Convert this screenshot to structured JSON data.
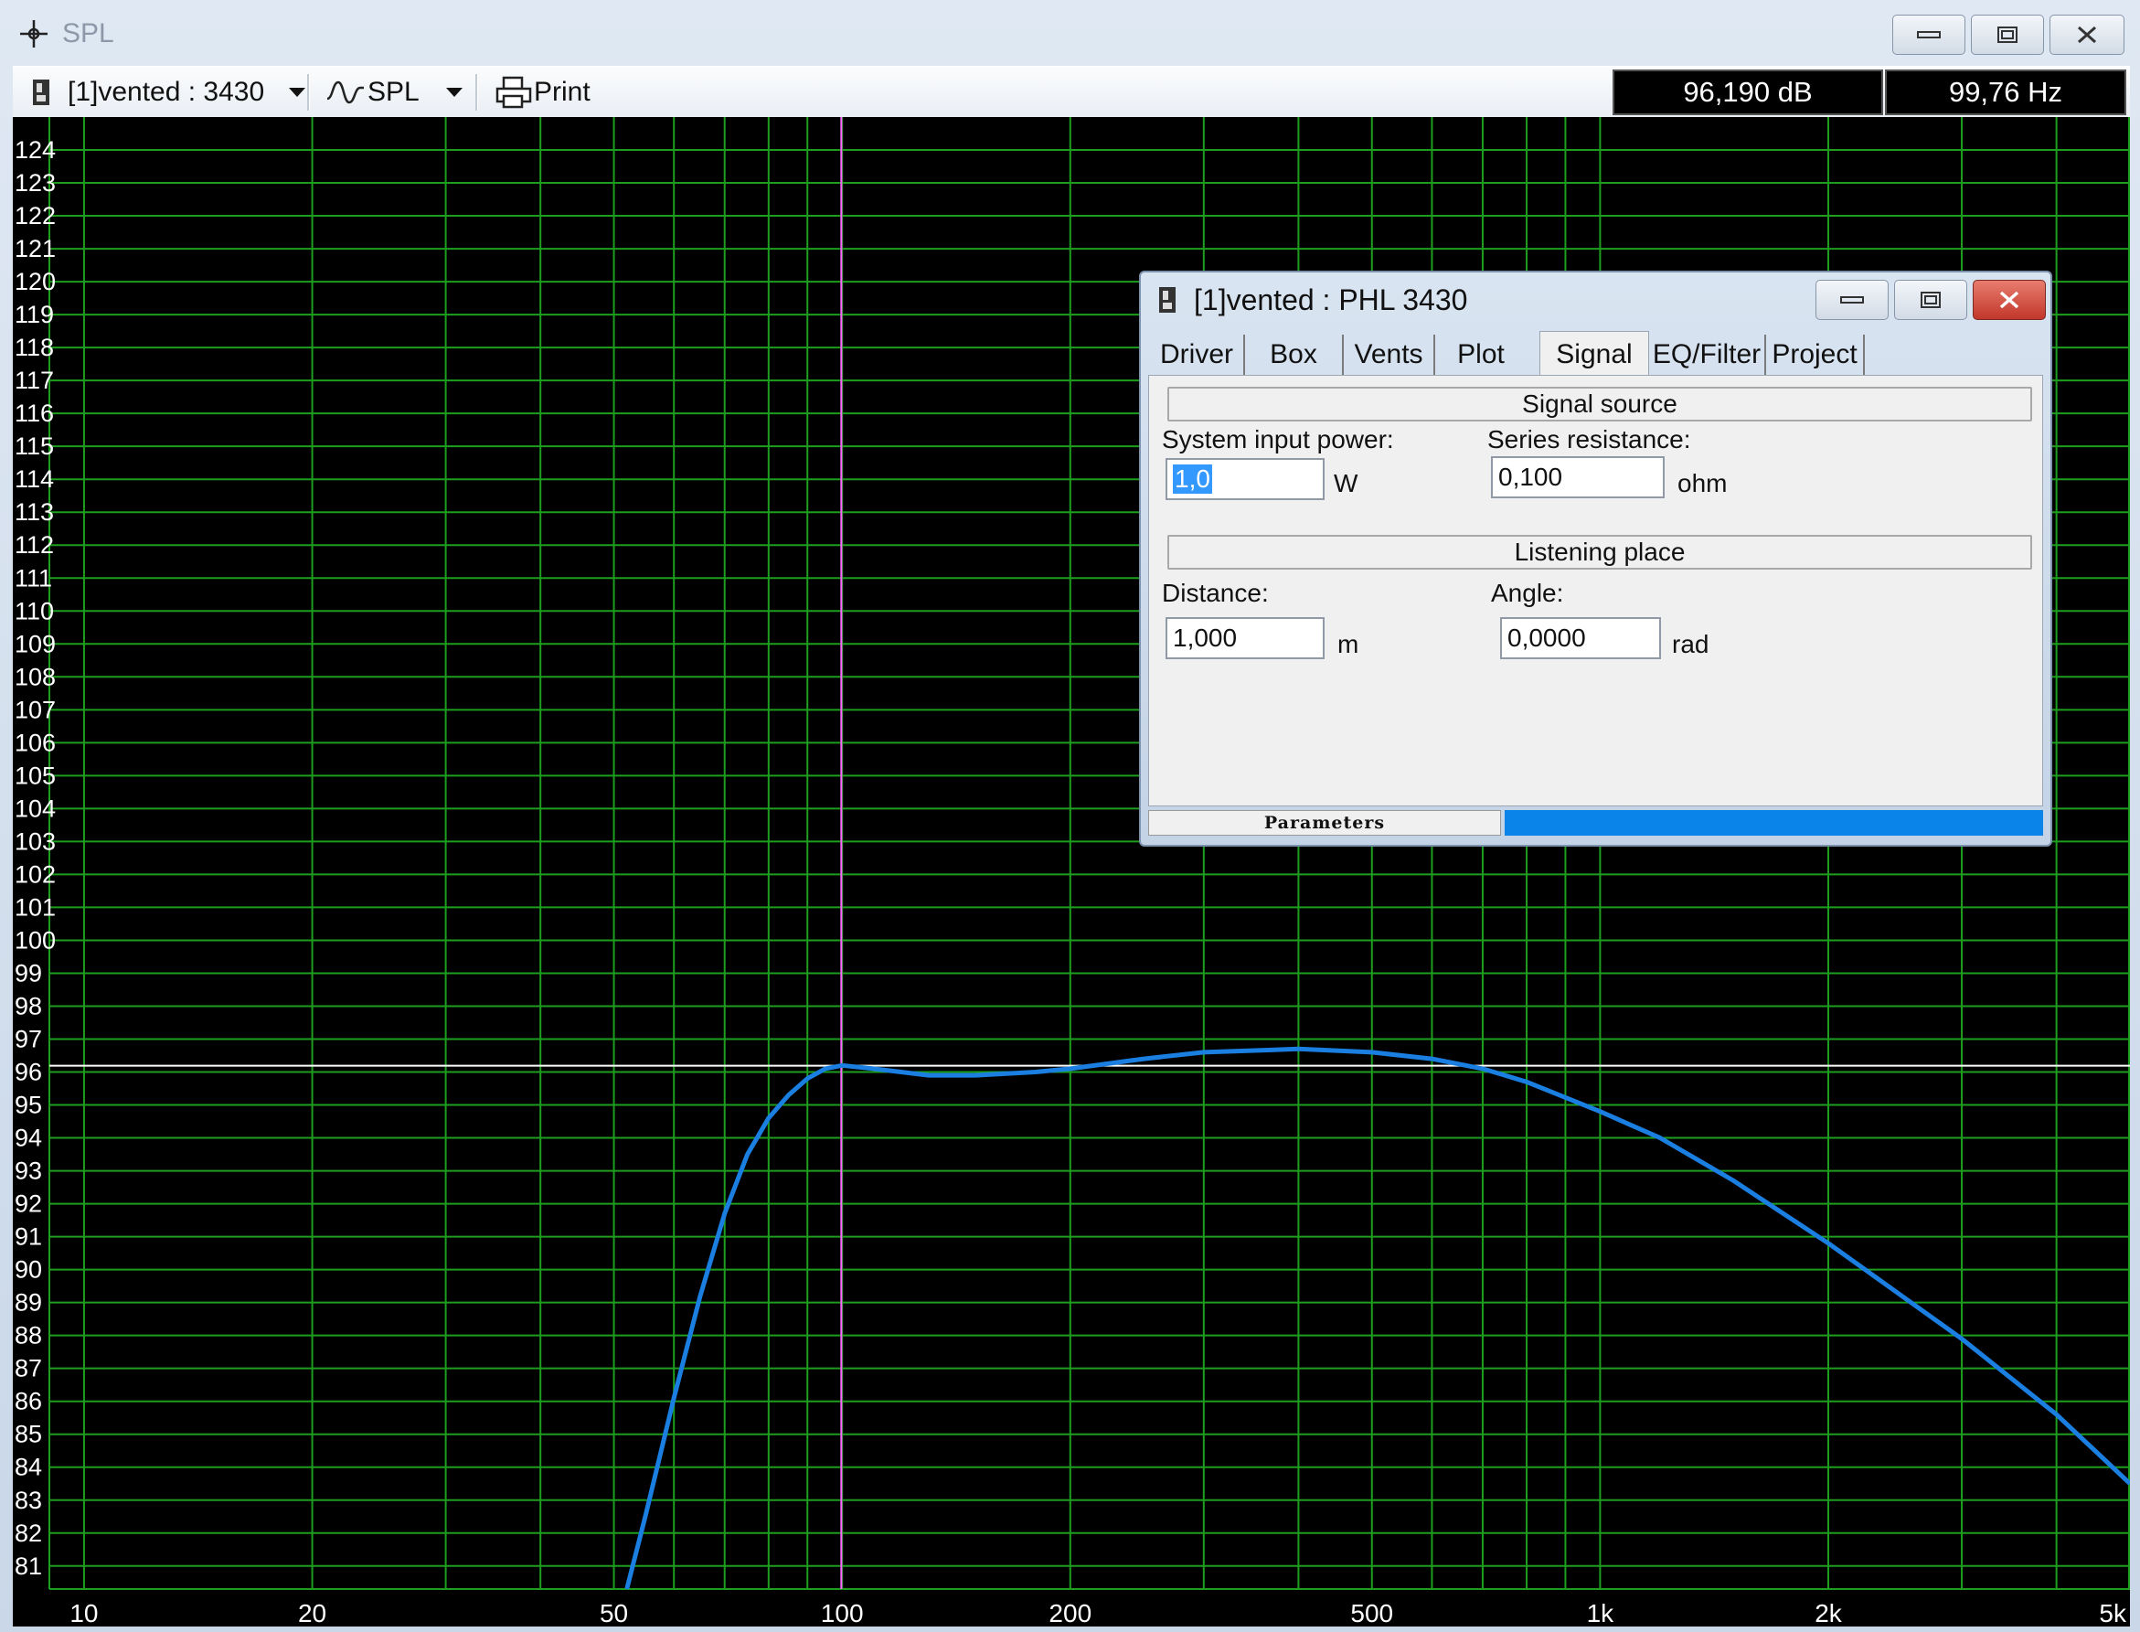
{
  "window": {
    "title": "SPL",
    "icon": "crosshair-icon"
  },
  "toolbar": {
    "project_selector": "[1]vented : 3430",
    "graph_selector": "SPL",
    "print_label": "Print"
  },
  "readouts": {
    "level": "96,190 dB",
    "frequency": "99,76 Hz"
  },
  "dialog": {
    "title": "[1]vented : PHL 3430",
    "tabs": [
      {
        "label": "Driver"
      },
      {
        "label": "Box"
      },
      {
        "label": "Vents"
      },
      {
        "label": "Plot"
      },
      {
        "label": "Signal",
        "active": true
      },
      {
        "label": "EQ/Filter"
      },
      {
        "label": "Project"
      }
    ],
    "signal_source": {
      "header": "Signal source",
      "power_label": "System input power:",
      "power_value": "1,0",
      "power_unit": "W",
      "resistance_label": "Series resistance:",
      "resistance_value": "0,100",
      "resistance_unit": "ohm"
    },
    "listening_place": {
      "header": "Listening place",
      "distance_label": "Distance:",
      "distance_value": "1,000",
      "distance_unit": "m",
      "angle_label": "Angle:",
      "angle_value": "0,0000",
      "angle_unit": "rad"
    },
    "status": {
      "left": "Parameters",
      "progress": 1.0
    }
  },
  "chart_data": {
    "type": "line",
    "x_scale": "log",
    "xlim": [
      9,
      5000
    ],
    "ylim": [
      80.3,
      125
    ],
    "x_ticks": [
      {
        "value": 10,
        "label": "10"
      },
      {
        "value": 20,
        "label": "20"
      },
      {
        "value": 50,
        "label": "50"
      },
      {
        "value": 100,
        "label": "100"
      },
      {
        "value": 200,
        "label": "200"
      },
      {
        "value": 500,
        "label": "500"
      },
      {
        "value": 1000,
        "label": "1k"
      },
      {
        "value": 2000,
        "label": "2k"
      },
      {
        "value": 5000,
        "label": "5k"
      }
    ],
    "y_ticks": [
      81,
      82,
      83,
      84,
      85,
      86,
      87,
      88,
      89,
      90,
      91,
      92,
      93,
      94,
      95,
      96,
      97,
      98,
      99,
      100,
      101,
      102,
      103,
      104,
      105,
      106,
      107,
      108,
      109,
      110,
      111,
      112,
      113,
      114,
      115,
      116,
      117,
      118,
      119,
      120,
      121,
      122,
      123,
      124
    ],
    "grid": true,
    "grid_color": "#1e9e1e",
    "cursor": {
      "x": 99.76,
      "y": 96.19,
      "x_color": "#ff66ff",
      "y_color": "#ffffff"
    },
    "series": [
      {
        "color": "#1a7fe0",
        "points": [
          [
            52,
            80.3
          ],
          [
            55,
            82.5
          ],
          [
            60,
            86.1
          ],
          [
            65,
            89.2
          ],
          [
            70,
            91.7
          ],
          [
            75,
            93.5
          ],
          [
            80,
            94.6
          ],
          [
            85,
            95.3
          ],
          [
            90,
            95.8
          ],
          [
            95,
            96.1
          ],
          [
            100,
            96.2
          ],
          [
            110,
            96.1
          ],
          [
            130,
            95.9
          ],
          [
            150,
            95.9
          ],
          [
            180,
            96.0
          ],
          [
            200,
            96.1
          ],
          [
            250,
            96.4
          ],
          [
            300,
            96.6
          ],
          [
            400,
            96.7
          ],
          [
            500,
            96.6
          ],
          [
            600,
            96.4
          ],
          [
            700,
            96.1
          ],
          [
            800,
            95.7
          ],
          [
            1000,
            94.8
          ],
          [
            1200,
            94.0
          ],
          [
            1500,
            92.7
          ],
          [
            2000,
            90.8
          ],
          [
            2500,
            89.2
          ],
          [
            3000,
            87.9
          ],
          [
            4000,
            85.6
          ],
          [
            5000,
            83.5
          ]
        ]
      }
    ]
  },
  "colors": {
    "plot_bg": "#000000",
    "curve": "#1a7fe0",
    "close_button": "#d9443a",
    "accent": "#0a84e8"
  }
}
